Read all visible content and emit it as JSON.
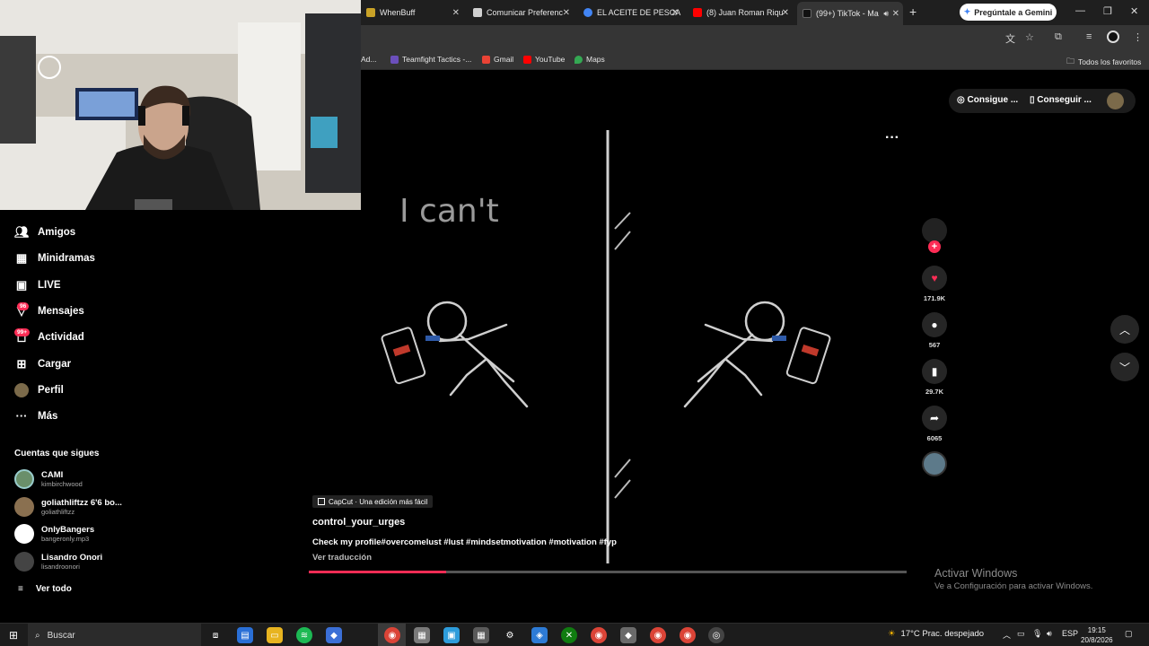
{
  "browser": {
    "tabs": [
      {
        "label": "WhenBuff",
        "color": "#c9a227"
      },
      {
        "label": "Comunicar Preferenc",
        "color": "#d0d0d0"
      },
      {
        "label": "EL ACEITE DE PESCA",
        "color": "#4285f4"
      },
      {
        "label": "(8) Juan Roman Riqu",
        "color": "#ff0000"
      },
      {
        "label": "(99+) TikTok - Ma",
        "color": "#111111"
      }
    ],
    "new_tab": "+",
    "gemini_label": "Pregúntale a Gemini",
    "bookmarks": [
      {
        "label": "Ad..."
      },
      {
        "label": "Teamfight Tactics -...",
        "color": "#6b4fbb"
      },
      {
        "label": "Gmail",
        "color": "#ea4335"
      },
      {
        "label": "YouTube",
        "color": "#ff0000"
      },
      {
        "label": "Maps",
        "color": "#34a853"
      }
    ],
    "all_favorites": "Todos los favoritos"
  },
  "sidebar": {
    "items": [
      {
        "label": "Amigos",
        "icon": "friends-icon"
      },
      {
        "label": "Minidramas",
        "icon": "film-icon"
      },
      {
        "label": "LIVE",
        "icon": "live-icon"
      },
      {
        "label": "Mensajes",
        "icon": "messages-icon",
        "badge": "96"
      },
      {
        "label": "Actividad",
        "icon": "activity-icon",
        "badge": "99+"
      },
      {
        "label": "Cargar",
        "icon": "upload-icon"
      },
      {
        "label": "Perfil",
        "icon": "profile-icon"
      },
      {
        "label": "Más",
        "icon": "more-icon"
      }
    ],
    "following_title": "Cuentas que sigues",
    "following": [
      {
        "name": "CAMI",
        "handle": "kimbirchwood",
        "color": "#6a8f6a"
      },
      {
        "name": "goliathliftzz 6'6 bo...",
        "handle": "goliathliftzz",
        "color": "#8a7050"
      },
      {
        "name": "OnlyBangers",
        "handle": "bangeronly.mp3",
        "color": "#ffffff"
      },
      {
        "name": "Lisandro Onori",
        "handle": "lisandroonori",
        "color": "#444444"
      }
    ],
    "see_all": "Ver todo"
  },
  "topbar": {
    "coins_label": "Consigue ...",
    "app_label": "Conseguir ..."
  },
  "video": {
    "caption_overlay": "I can't",
    "capcut_label": "CapCut · Una edición más fácil",
    "author": "control_your_urges",
    "description": "Check my profile#overcomelust #lust #mindsetmotivation #motivation #fyp",
    "translate": "Ver traducción",
    "progress": 0.23
  },
  "actions": {
    "likes": "171.9K",
    "comments": "567",
    "saves": "29.7K",
    "shares": "6065"
  },
  "watermark": {
    "title": "Activar Windows",
    "subtitle": "Ve a Configuración para activar Windows."
  },
  "taskbar": {
    "search_placeholder": "Buscar",
    "weather": "17°C  Prac. despejado",
    "lang": "ESP",
    "time": "19:15",
    "date": "20/8/2026"
  }
}
